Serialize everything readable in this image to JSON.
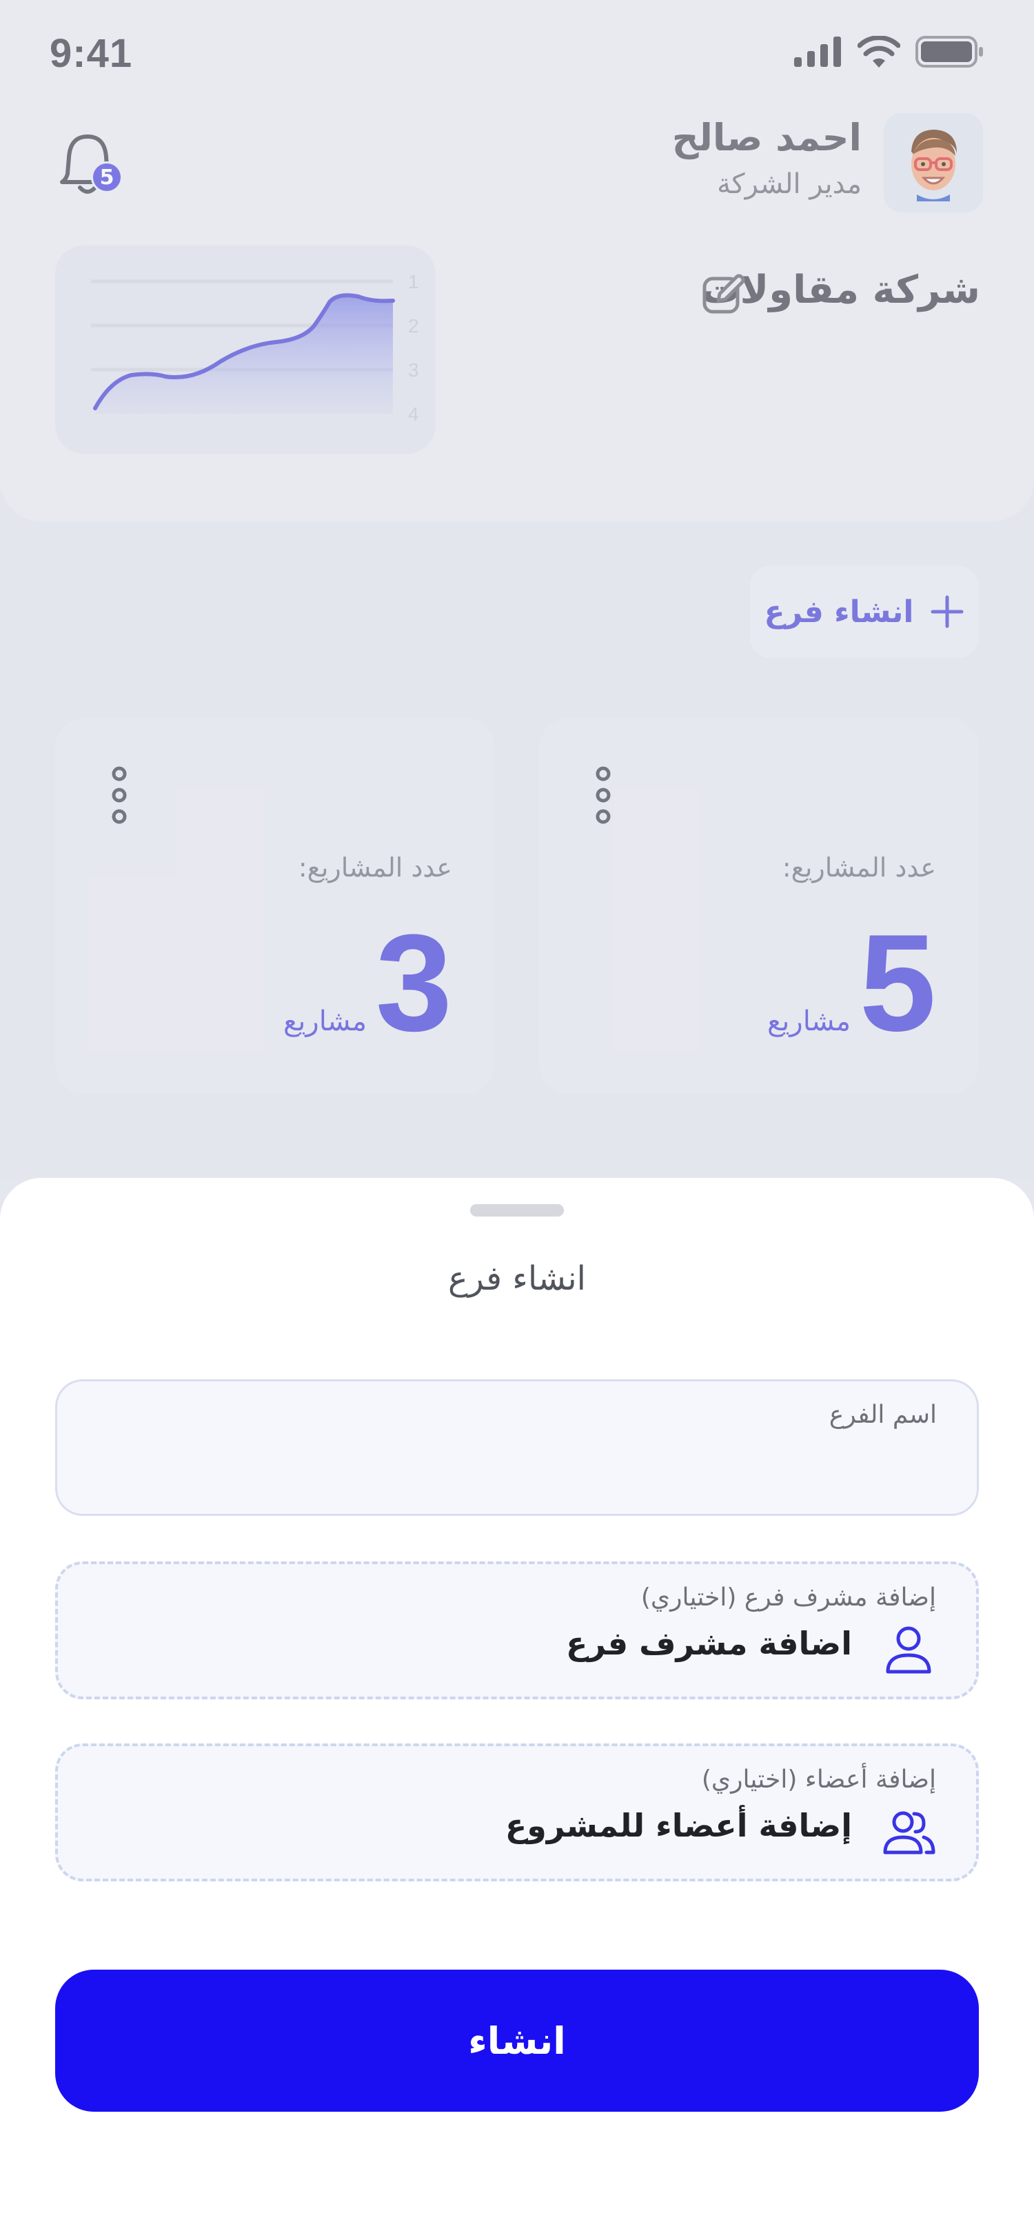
{
  "status_bar": {
    "time": "9:41"
  },
  "profile": {
    "name": "احمد صالح",
    "role": "مدير الشركة",
    "notifications_count": "5"
  },
  "company": {
    "name": "شركة مقاولات"
  },
  "mini_chart": {
    "y_tick_labels": [
      "1",
      "2",
      "3",
      "4"
    ],
    "accent_color": "#5a55d8"
  },
  "create_branch_chip": {
    "label": "انشاء فرع"
  },
  "branches": [
    {
      "count_label": "عدد المشاريع:",
      "count": "5",
      "unit": "مشاريع"
    },
    {
      "count_label": "عدد المشاريع:",
      "count": "3",
      "unit": "مشاريع"
    }
  ],
  "sheet": {
    "title": "انشاء فرع",
    "branch_name": {
      "label": "اسم الفرع",
      "value": ""
    },
    "supervisor": {
      "label": "إضافة مشرف فرع (اختياري)",
      "value": "اضافة مشرف فرع",
      "icon": "user-icon"
    },
    "members": {
      "label": "إضافة أعضاء (اختياري)",
      "value": "إضافة أعضاء للمشروع",
      "icon": "users-icon"
    },
    "submit_label": "انشاء"
  },
  "colors": {
    "primary": "#1a0ff2",
    "accent": "#5550dc",
    "badge": "#5b55e0"
  }
}
